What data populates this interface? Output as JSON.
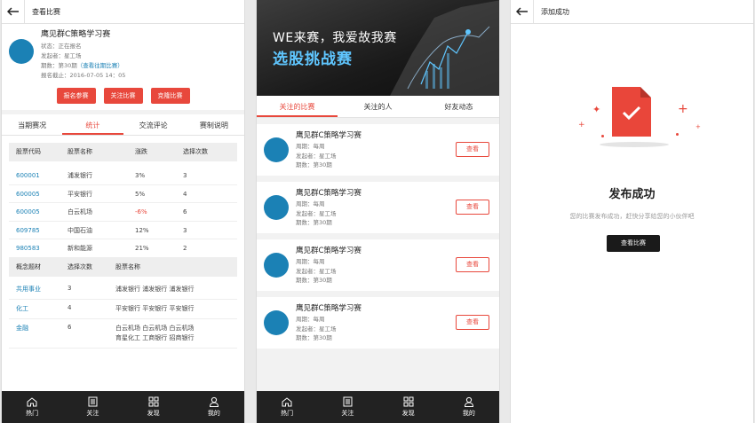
{
  "p1": {
    "header_title": "查看比赛",
    "contest_name": "鹰见群C策略学习赛",
    "status": "状态：正在报名",
    "initiator": "发起者：星工场",
    "period_prefix": "期数：第30期",
    "period_link": "（查看往期比赛）",
    "deadline": "报名截止：2016-07-05 14：05",
    "buttons": [
      "报名参赛",
      "关注比赛",
      "克隆比赛"
    ],
    "tabs": [
      "当期赛况",
      "统计",
      "交流评论",
      "赛制说明"
    ],
    "stock_headers": [
      "股票代码",
      "股票名称",
      "涨跌",
      "选择次数"
    ],
    "stocks": [
      {
        "code": "600001",
        "name": "浦发银行",
        "change": "3%",
        "count": "3",
        "neg": false
      },
      {
        "code": "600005",
        "name": "平安银行",
        "change": "5%",
        "count": "4",
        "neg": false
      },
      {
        "code": "600005",
        "name": "白云机场",
        "change": "-6%",
        "count": "6",
        "neg": true
      },
      {
        "code": "609785",
        "name": "中国石油",
        "change": "12%",
        "count": "3",
        "neg": false
      },
      {
        "code": "980583",
        "name": "新和能源",
        "change": "21%",
        "count": "2",
        "neg": false
      }
    ],
    "concept_headers": [
      "概念题材",
      "选择次数",
      "股票名称"
    ],
    "concepts": [
      {
        "name": "共用事业",
        "count": "3",
        "stocks_l1": "浦发银行  浦发银行  浦发银行",
        "stocks_l2": ""
      },
      {
        "name": "化工",
        "count": "4",
        "stocks_l1": "平安银行  平安银行  平安银行",
        "stocks_l2": ""
      },
      {
        "name": "金融",
        "count": "6",
        "stocks_l1": "白云机场  白云机场  白云机场",
        "stocks_l2": "育星化工  工商银行  招商银行"
      }
    ]
  },
  "p2": {
    "banner_line1": "WE来赛，我爱故我赛",
    "banner_line2": "选股挑战赛",
    "tabs": [
      "关注的比赛",
      "关注的人",
      "好友动态"
    ],
    "cards": [
      {
        "name": "鹰见群C策略学习赛",
        "cycle": "周期：每周",
        "initiator": "发起者：星工场",
        "period": "期数：第30期",
        "btn": "查看"
      },
      {
        "name": "鹰见群C策略学习赛",
        "cycle": "周期：每周",
        "initiator": "发起者：星工场",
        "period": "期数：第30期",
        "btn": "查看"
      },
      {
        "name": "鹰见群C策略学习赛",
        "cycle": "周期：每周",
        "initiator": "发起者：星工场",
        "period": "期数：第30期",
        "btn": "查看"
      },
      {
        "name": "鹰见群C策略学习赛",
        "cycle": "周期：每周",
        "initiator": "发起者：星工场",
        "period": "期数：第30期",
        "btn": "查看"
      }
    ]
  },
  "p3": {
    "header_title": "添加成功",
    "title": "发布成功",
    "subtitle": "您的比赛发布成功，赶快分享给您的小伙伴吧",
    "button": "查看比赛"
  },
  "tabbar": [
    "热门",
    "关注",
    "发现",
    "我的"
  ],
  "colors": {
    "accent": "#e8483c",
    "avatar": "#1b81b5",
    "tabbar": "#222222"
  }
}
